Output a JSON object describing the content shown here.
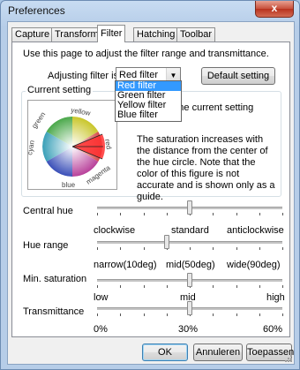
{
  "window": {
    "title": "Preferences",
    "close_glyph": "x"
  },
  "tabs": [
    {
      "label": "Capture"
    },
    {
      "label": "Transform"
    },
    {
      "label": "Filter"
    },
    {
      "label": "Hatching"
    },
    {
      "label": "Toolbar"
    }
  ],
  "filter": {
    "intro": "Use this page to adjust the filter range and transmittance.",
    "adjusting_label": "Adjusting filter is:",
    "adjusting_value": "Red filter",
    "default_button": "Default setting",
    "dropdown_options": [
      "Red filter",
      "Green filter",
      "Yellow filter",
      "Blue filter"
    ],
    "current_setting": {
      "label": "Current setting",
      "text1": "shows the current setting",
      "text2": "d filter.",
      "text3": "The saturation increases with the distance from the center of the hue circle. Note that the color of this figure is not accurate and is shown only as a guide.",
      "wheel_labels": [
        "yellow",
        "green",
        "red",
        "cyan",
        "magenta",
        "blue"
      ]
    },
    "sliders": {
      "central_hue": {
        "label": "Central hue",
        "min": "clockwise",
        "mid": "standard",
        "max": "anticlockwise",
        "value_fraction": 0.5
      },
      "hue_range": {
        "label": "Hue range",
        "min": "narrow(10deg)",
        "mid": "mid(50deg)",
        "max": "wide(90deg)",
        "value_fraction": 0.375
      },
      "min_saturation": {
        "label": "Min. saturation",
        "min": "low",
        "mid": "mid",
        "max": "high",
        "value_fraction": 0.5
      },
      "transmittance": {
        "label": "Transmittance",
        "min": "0%",
        "mid": "30%",
        "max": "60%",
        "value_fraction": 0.5
      }
    }
  },
  "buttons": {
    "ok": "OK",
    "cancel": "Annuleren",
    "apply": "Toepassen"
  }
}
